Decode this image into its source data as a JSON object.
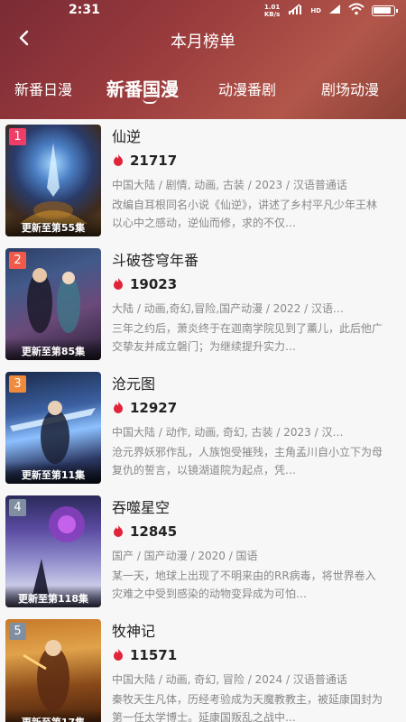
{
  "status_bar": {
    "time": "2:31",
    "net_speed_value": "1.01",
    "net_speed_unit": "KB/s",
    "hd_label": "HD"
  },
  "nav": {
    "title": "本月榜单"
  },
  "tabs": [
    {
      "label": "新番日漫",
      "active": false
    },
    {
      "label": "新番国漫",
      "active": true
    },
    {
      "label": "动漫番剧",
      "active": false
    },
    {
      "label": "剧场动漫",
      "active": false
    }
  ],
  "colors": {
    "accent_red": "#e0243a",
    "rank_top": "#ee3e67",
    "rank_2": "#ef5a4a",
    "rank_3": "#f08a3c",
    "rank_other": "#7f8ea0"
  },
  "items": [
    {
      "rank": "1",
      "title": "仙逆",
      "heat": "21717",
      "tags": "中国大陆 / 剧情, 动画, 古装 / 2023 / 汉语普通话",
      "desc": "改编自耳根同名小说《仙逆》，讲述了乡村平凡少年王林以心中之感动，逆仙而修，求的不仅…",
      "cover_caption": "更新至第55集"
    },
    {
      "rank": "2",
      "title": "斗破苍穹年番",
      "heat": "19023",
      "tags": "大陆 / 动画,奇幻,冒险,国产动漫 / 2022 / 汉语…",
      "desc": "三年之约后，萧炎终于在迦南学院见到了薰儿，此后他广交挚友并成立磐门；为继续提升实力…",
      "cover_caption": "更新至第85集"
    },
    {
      "rank": "3",
      "title": "沧元图",
      "heat": "12927",
      "tags": "中国大陆 / 动作, 动画, 奇幻, 古装 / 2023 / 汉…",
      "desc": "沧元界妖邪作乱，人族饱受摧残，主角孟川自小立下为母复仇的誓言，以镜湖道院为起点，凭…",
      "cover_caption": "更新至第11集"
    },
    {
      "rank": "4",
      "title": "吞噬星空",
      "heat": "12845",
      "tags": "国产 / 国产动漫 / 2020 / 国语",
      "desc": "某一天，地球上出现了不明来由的RR病毒，将世界卷入灾难之中受到感染的动物变异成为可怕…",
      "cover_caption": "更新至第118集"
    },
    {
      "rank": "5",
      "title": "牧神记",
      "heat": "11571",
      "tags": "中国大陆 / 动画, 奇幻, 冒险 / 2024 / 汉语普通话",
      "desc": "秦牧天生凡体，历经考验成为天魔教教主，被延康国封为第一任太学博士。延康国叛乱之战中…",
      "cover_caption": "更新至第17集"
    }
  ]
}
